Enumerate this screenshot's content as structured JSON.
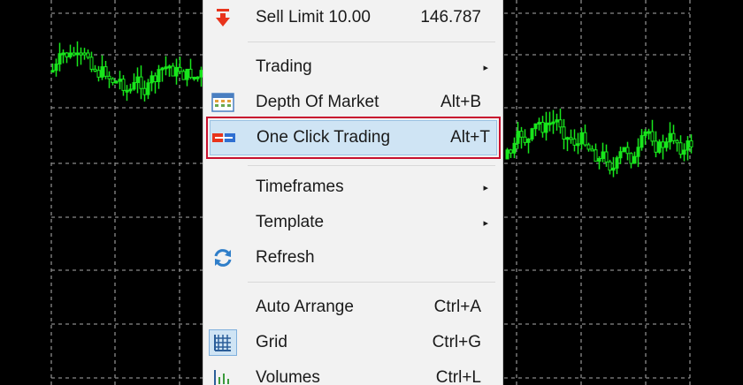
{
  "chart": {
    "grid_color": "#8a8a8a",
    "candle_color": "#18e61c"
  },
  "menu": {
    "items": [
      {
        "label": "Sell Limit 10.00",
        "shortcut": "146.787",
        "icon": "sell-arrow-icon"
      },
      {
        "label": "Trading",
        "submenu": "▸"
      },
      {
        "label": "Depth Of Market",
        "shortcut": "Alt+B",
        "icon": "depth-of-market-icon"
      },
      {
        "label": "One Click Trading",
        "shortcut": "Alt+T",
        "icon": "one-click-trading-icon",
        "highlighted": true
      },
      {
        "label": "Timeframes",
        "submenu": "▸"
      },
      {
        "label": "Template",
        "submenu": "▸"
      },
      {
        "label": "Refresh",
        "icon": "refresh-icon"
      },
      {
        "label": "Auto Arrange",
        "shortcut": "Ctrl+A"
      },
      {
        "label": "Grid",
        "shortcut": "Ctrl+G",
        "icon": "grid-icon"
      },
      {
        "label": "Volumes",
        "shortcut": "Ctrl+L",
        "icon": "volumes-icon"
      }
    ],
    "highlight_color": "#cfe4f4",
    "annotation_color": "#c8102e"
  }
}
